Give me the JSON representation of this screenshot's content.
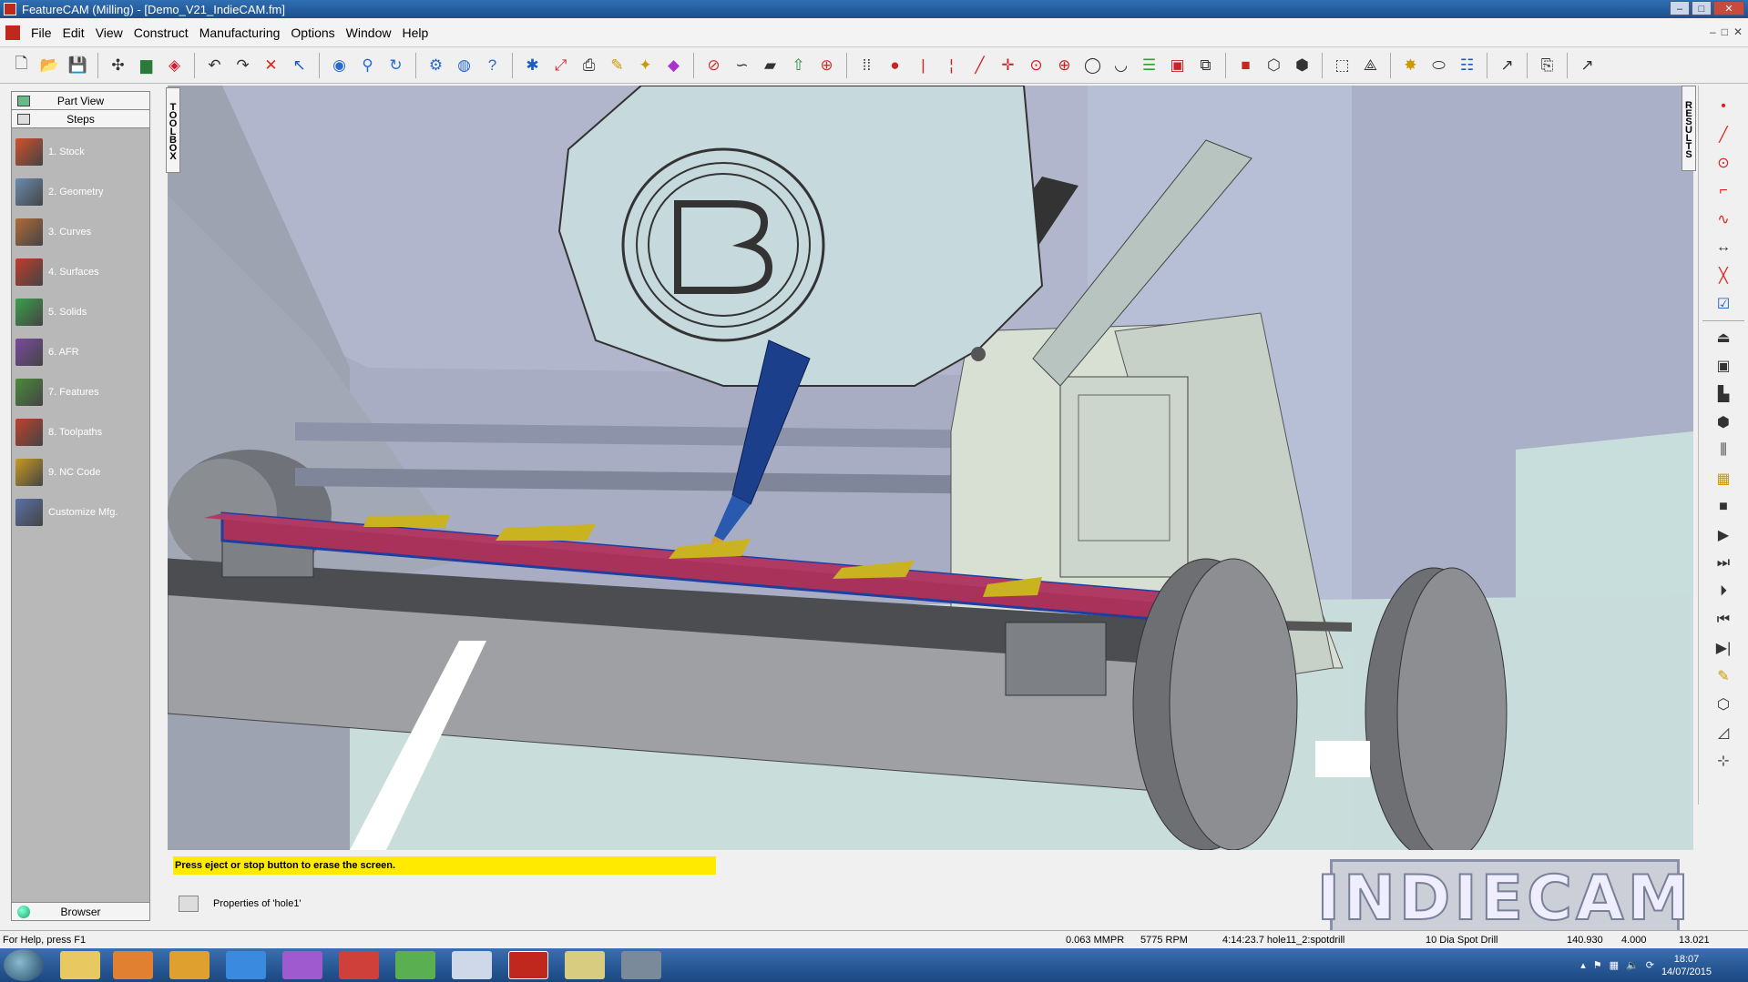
{
  "window": {
    "title": "FeatureCAM (Milling) - [Demo_V21_IndieCAM.fm]",
    "min": "–",
    "max": "□",
    "close": "✕"
  },
  "menu": {
    "items": [
      "File",
      "Edit",
      "View",
      "Construct",
      "Manufacturing",
      "Options",
      "Window",
      "Help"
    ]
  },
  "left_panel": {
    "part_view": "Part View",
    "steps_header": "Steps",
    "steps": [
      {
        "label": "1. Stock",
        "color": "#d2502a"
      },
      {
        "label": "2. Geometry",
        "color": "#6a8cb0"
      },
      {
        "label": "3. Curves",
        "color": "#b06a38"
      },
      {
        "label": "4. Surfaces",
        "color": "#c23b2a"
      },
      {
        "label": "5. Solids",
        "color": "#3aa04a"
      },
      {
        "label": "6. AFR",
        "color": "#7a4aa0"
      },
      {
        "label": "7. Features",
        "color": "#4a8a3a"
      },
      {
        "label": "8. Toolpaths",
        "color": "#c0402a"
      },
      {
        "label": "9. NC Code",
        "color": "#c89a20"
      },
      {
        "label": "Customize Mfg.",
        "color": "#5a70a8"
      }
    ],
    "browser": "Browser"
  },
  "side_tabs": {
    "toolbox": "TOOLBOX",
    "results": "RESULTS"
  },
  "message": "Press eject or stop button to erase the screen.",
  "properties": "Properties of 'hole1'",
  "watermark": "INDIECAM",
  "status": {
    "help": "For Help, press F1",
    "feed": "0.063 MMPR",
    "speed": "5775 RPM",
    "time_op": "4:14:23.7  hole11_2:spotdrill",
    "tool": "10 Dia Spot Drill",
    "x": "140.930",
    "y": "4.000",
    "z": "13.021"
  },
  "taskbar": {
    "time": "18:07",
    "date": "14/07/2015"
  },
  "colors": {
    "part_top": "#a8325a",
    "part_edge": "#1f3fa0",
    "clamp": "#c9b320",
    "tool": "#1c3f8c",
    "spindle": "#c6dade"
  }
}
